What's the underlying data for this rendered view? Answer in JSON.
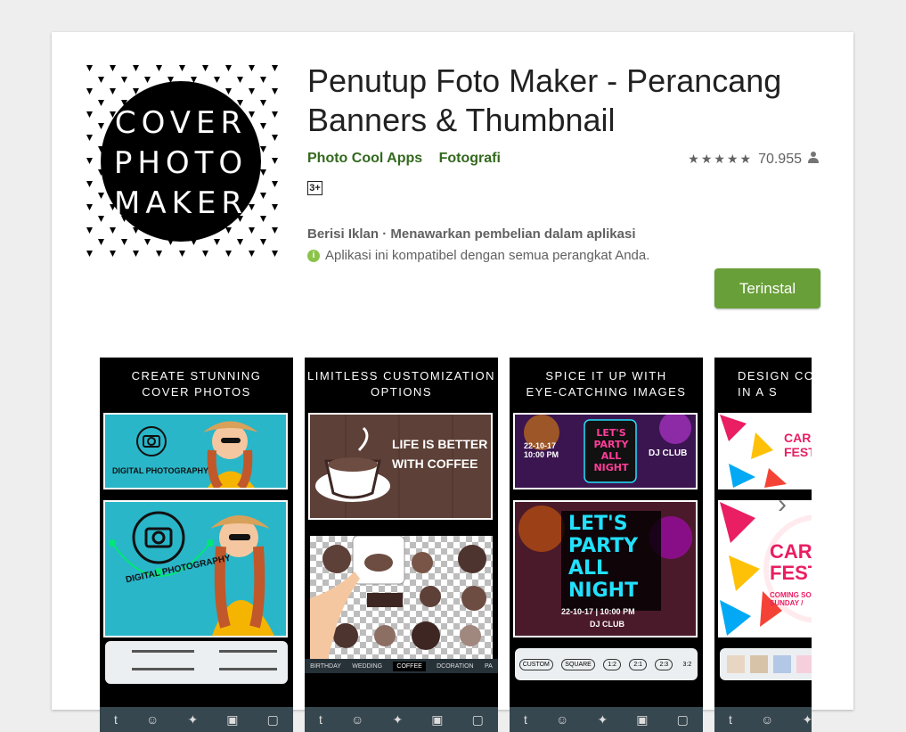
{
  "app": {
    "title": "Penutup Foto Maker - Perancang Banners & Thumbnail",
    "developer": "Photo Cool Apps",
    "category": "Fotografi",
    "rating_count": "70.955",
    "content_rating": "3+",
    "ads_info": "Berisi Iklan · Menawarkan pembelian dalam aplikasi",
    "compat_info": "Aplikasi ini kompatibel dengan semua perangkat Anda.",
    "install_label": "Terinstal",
    "icon_text": [
      "COVER",
      "PHOTO",
      "MAKER"
    ]
  },
  "screenshots": [
    {
      "caption": "CREATE STUNNING\nCOVER PHOTOS",
      "panel_label_1": "DIGITAL PHOTOGRAPHY",
      "panel_label_2": "DIGITAL PHOTOGRAPHY"
    },
    {
      "caption": "LIMITLESS CUSTOMIZATION\nOPTIONS",
      "panel_label_1": "LIFE IS BETTER\nWITH COFFEE",
      "tabs": [
        "BIRTHDAY",
        "WEDDING",
        "COFFEE",
        "DCORATION",
        "PA"
      ]
    },
    {
      "caption": "SPICE IT UP WITH\nEYE-CATCHING IMAGES",
      "neon_1": "LET'S PARTY ALL NIGHT",
      "date_1": "22-10-17\n10:00 PM",
      "club_1": "DJ CLUB",
      "neon_2": "LET'S\nPARTY\nALL\nNIGHT",
      "date_2": "22-10-17 | 10:00 PM",
      "club_2": "DJ CLUB",
      "ratios": [
        "CUSTOM",
        "SQUARE",
        "1:2",
        "2:1",
        "2:3",
        "3:2"
      ]
    },
    {
      "caption": "DESIGN COV\nIN A S",
      "carn_1": "CARN\nFEST",
      "carn_2": "CARN\nFEST",
      "coming": "COMING SOON\nSUNDAY /"
    }
  ],
  "colors": {
    "accent": "#689f38",
    "developer_link": "#33691e",
    "neon_pink": "#ff3d9a",
    "neon_cyan": "#22e0ff"
  }
}
